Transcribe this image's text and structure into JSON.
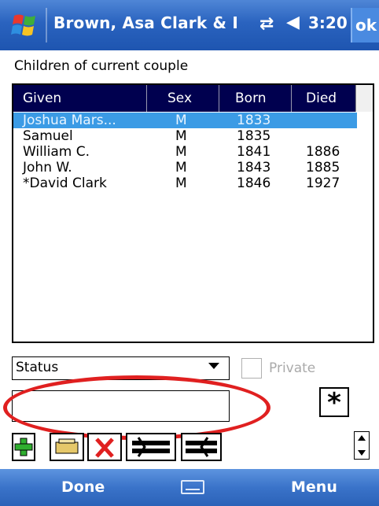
{
  "titlebar": {
    "title": "Brown, Asa Clark & I",
    "clock": "3:20",
    "ok_label": "ok",
    "connectivity_icon": "connectivity-icon",
    "volume_icon": "volume-icon"
  },
  "section_label": "Children of current couple",
  "list": {
    "columns": [
      "Given",
      "Sex",
      "Born",
      "Died"
    ],
    "rows": [
      {
        "given": "Joshua Mars...",
        "sex": "M",
        "born": "1833",
        "died": ""
      },
      {
        "given": "Samuel",
        "sex": "M",
        "born": "1835",
        "died": ""
      },
      {
        "given": "William C.",
        "sex": "M",
        "born": "1841",
        "died": "1886"
      },
      {
        "given": "John W.",
        "sex": "M",
        "born": "1843",
        "died": "1885"
      },
      {
        "given": "*David Clark",
        "sex": "M",
        "born": "1846",
        "died": "1927"
      }
    ],
    "selected_index": 0
  },
  "status": {
    "selected": "Status",
    "private_label": "Private",
    "text_value": ""
  },
  "star_button": "*",
  "toolbar": {
    "buttons": [
      "add-icon",
      "edit-icon",
      "delete-icon",
      "move-left-icon",
      "move-right-icon"
    ]
  },
  "menubar": {
    "left_label": "Done",
    "right_label": "Menu"
  },
  "colors": {
    "title_bar": "#2a63bf",
    "header_bg": "#00004f",
    "selected_row": "#3b9be5",
    "highlight_ellipse": "#e02020"
  }
}
